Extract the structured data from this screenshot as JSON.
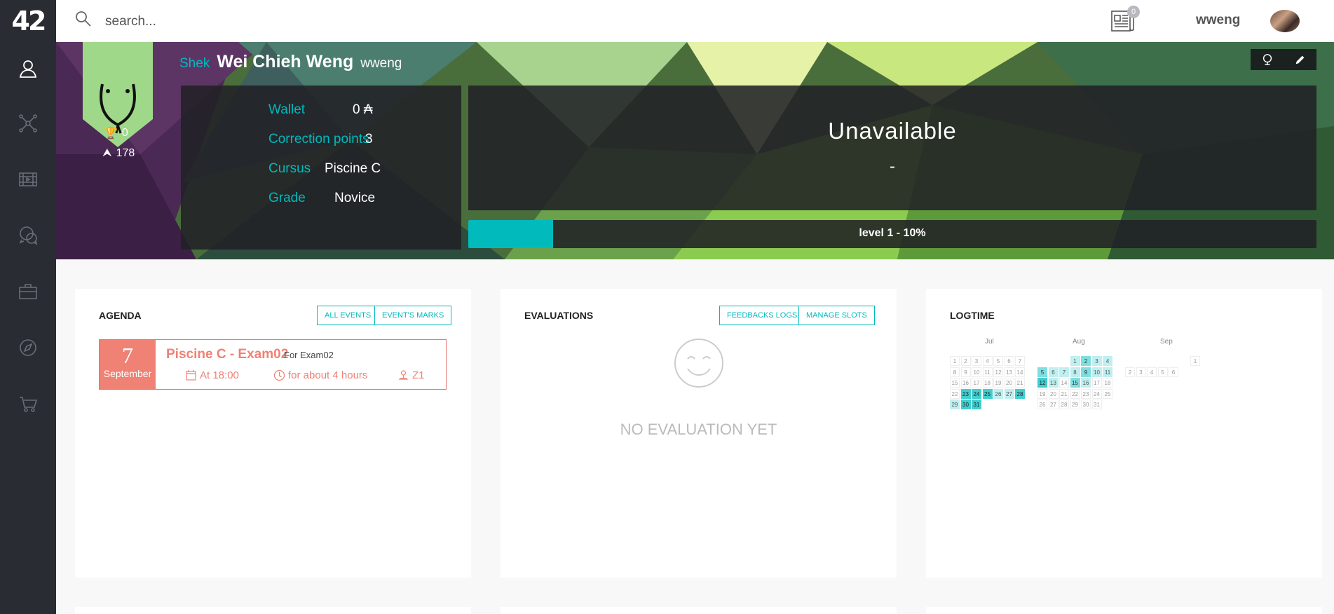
{
  "app": {
    "logo": "42"
  },
  "topbar": {
    "search_placeholder": "search...",
    "news_count": "0",
    "login": "wweng"
  },
  "profile": {
    "title": "Shek",
    "full_name": "Wei Chieh Weng",
    "login": "wweng",
    "achievements": "0",
    "score": "178",
    "info": [
      {
        "label": "Wallet",
        "value": "0 ₳"
      },
      {
        "label": "Correction points",
        "value": "3"
      },
      {
        "label": "Cursus",
        "value": "Piscine C"
      },
      {
        "label": "Grade",
        "value": "Novice"
      }
    ],
    "location_status": "Unavailable",
    "location_sub": "-",
    "level_text": "level 1 - 10%",
    "level_progress": 0.1
  },
  "agenda": {
    "title": "AGENDA",
    "buttons": [
      "ALL EVENTS",
      "EVENT'S MARKS"
    ],
    "event": {
      "day": "7",
      "month": "September",
      "name": "Piscine C - Exam02",
      "desc": "For Exam02",
      "time": "At 18:00",
      "duration": "for about 4 hours",
      "location": "Z1"
    }
  },
  "evaluations": {
    "title": "EVALUATIONS",
    "buttons": [
      "FEEDBACKS LOGS",
      "MANAGE SLOTS"
    ],
    "empty_text": "NO EVALUATION YET"
  },
  "logtime": {
    "title": "LOGTIME",
    "months": [
      {
        "name": "Jul",
        "rows": [
          [
            [
              "1",
              0
            ],
            [
              "2",
              0
            ],
            [
              "3",
              0
            ],
            [
              "4",
              0
            ],
            [
              "5",
              0
            ],
            [
              "6",
              0
            ],
            [
              "7",
              0
            ]
          ],
          [
            [
              "8",
              0
            ],
            [
              "9",
              0
            ],
            [
              "10",
              0
            ],
            [
              "11",
              0
            ],
            [
              "12",
              0
            ],
            [
              "13",
              0
            ],
            [
              "14",
              0
            ]
          ],
          [
            [
              "15",
              0
            ],
            [
              "16",
              0
            ],
            [
              "17",
              0
            ],
            [
              "18",
              0
            ],
            [
              "19",
              0
            ],
            [
              "20",
              0
            ],
            [
              "21",
              0
            ]
          ],
          [
            [
              "22",
              0
            ],
            [
              "23",
              3
            ],
            [
              "24",
              3
            ],
            [
              "25",
              3
            ],
            [
              "26",
              1
            ],
            [
              "27",
              1
            ],
            [
              "28",
              3
            ]
          ],
          [
            [
              "29",
              1
            ],
            [
              "30",
              3
            ],
            [
              "31",
              3
            ]
          ]
        ]
      },
      {
        "name": "Aug",
        "rows": [
          [
            [
              "",
              0
            ],
            [
              "",
              0
            ],
            [
              "",
              0
            ],
            [
              "1",
              1
            ],
            [
              "2",
              2
            ],
            [
              "3",
              1
            ],
            [
              "4",
              1
            ]
          ],
          [
            [
              "5",
              2
            ],
            [
              "6",
              1
            ],
            [
              "7",
              1
            ],
            [
              "8",
              1
            ],
            [
              "9",
              2
            ],
            [
              "10",
              1
            ],
            [
              "11",
              1
            ]
          ],
          [
            [
              "12",
              3
            ],
            [
              "13",
              1
            ],
            [
              "14",
              0
            ],
            [
              "15",
              2
            ],
            [
              "16",
              1
            ],
            [
              "17",
              0
            ],
            [
              "18",
              0
            ]
          ],
          [
            [
              "19",
              0
            ],
            [
              "20",
              0
            ],
            [
              "21",
              0
            ],
            [
              "22",
              0
            ],
            [
              "23",
              0
            ],
            [
              "24",
              0
            ],
            [
              "25",
              0
            ]
          ],
          [
            [
              "26",
              0
            ],
            [
              "27",
              0
            ],
            [
              "28",
              0
            ],
            [
              "29",
              0
            ],
            [
              "30",
              0
            ],
            [
              "31",
              0
            ]
          ]
        ]
      },
      {
        "name": "Sep",
        "rows": [
          [
            [
              "",
              0
            ],
            [
              "",
              0
            ],
            [
              "",
              0
            ],
            [
              "",
              0
            ],
            [
              "",
              0
            ],
            [
              "",
              0
            ],
            [
              "1",
              0
            ]
          ],
          [
            [
              "2",
              0
            ],
            [
              "3",
              0
            ],
            [
              "4",
              0
            ],
            [
              "5",
              0
            ],
            [
              "6",
              0
            ]
          ]
        ]
      }
    ]
  },
  "colors": {
    "accent": "#00babc",
    "sidebar": "#2a2c33",
    "event": "#ef8175",
    "coalition": "#9fd889"
  }
}
